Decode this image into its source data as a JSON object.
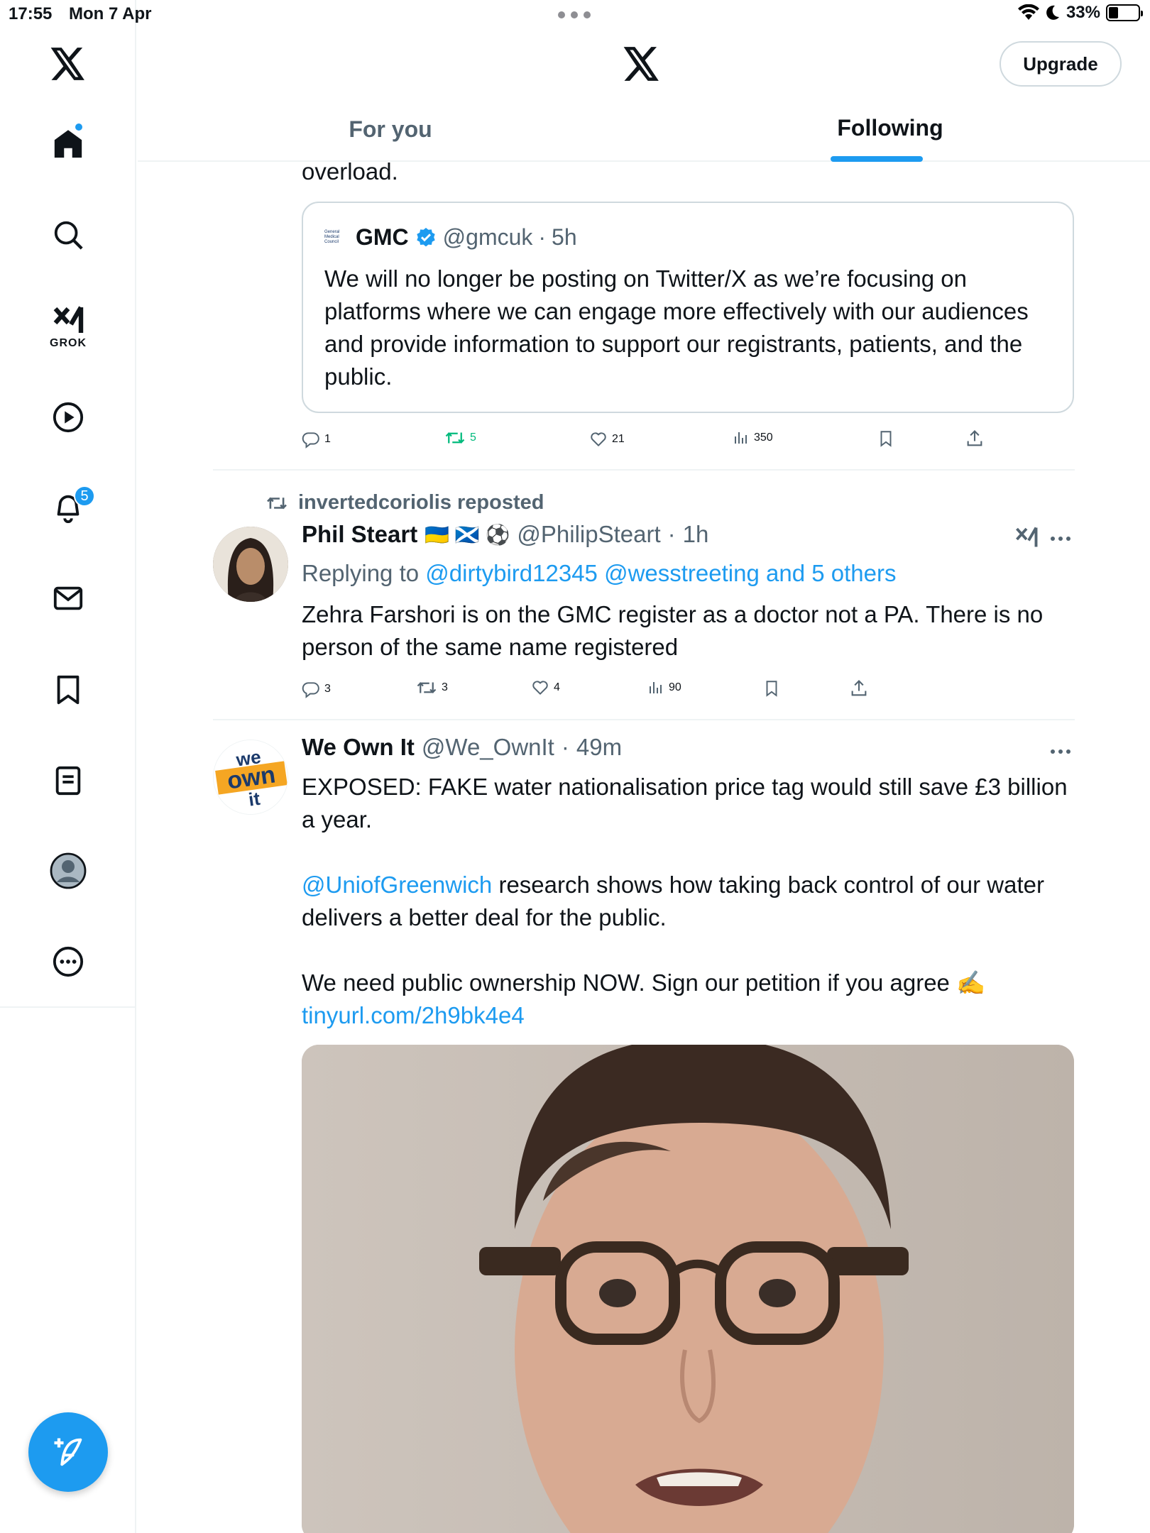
{
  "status_bar": {
    "time": "17:55",
    "date": "Mon 7 Apr",
    "battery": "33%",
    "battery_level": 0.33
  },
  "sidebar": {
    "grok_label": "GROK",
    "notifications_badge": "5"
  },
  "header": {
    "upgrade_label": "Upgrade",
    "tabs": [
      {
        "label": "For you",
        "selected": false
      },
      {
        "label": "Following",
        "selected": true
      }
    ]
  },
  "tweet1": {
    "text_tail": "overload.",
    "quote": {
      "name": "GMC",
      "logo_text": [
        "General",
        "Medical",
        "Council"
      ],
      "handle": "@gmcuk",
      "sep": "·",
      "time": "5h",
      "text": "We will no longer be posting on Twitter/X as we’re focusing on platforms where we can engage more effectively with our audiences and provide information to support our registrants, patients, and the public."
    },
    "replies": "1",
    "reposts": "5",
    "likes": "21",
    "views": "350"
  },
  "tweet2": {
    "repost_label": "invertedcoriolis reposted",
    "name": "Phil Steart",
    "name_emoji": "🇺🇦 🏴󠁧󠁢󠁳󠁣󠁴󠁿 ⚽",
    "handle": "@PhilipSteart",
    "sep": "·",
    "time": "1h",
    "replying_prefix": "Replying to",
    "replying_to": "@dirtybird12345 @wesstreeting and 5 others",
    "text": "Zehra Farshori is on the GMC register as a doctor not a PA. There is no person of the same name registered",
    "replies": "3",
    "reposts": "3",
    "likes": "4",
    "views": "90"
  },
  "tweet3": {
    "name": "We Own It",
    "avatar_text": [
      "we",
      "own",
      "it"
    ],
    "handle": "@We_OwnIt",
    "sep": "·",
    "time": "49m",
    "text1": "EXPOSED: FAKE water nationalisation price tag would still save £3 billion a year.",
    "mention": "@UniofGreenwich",
    "text2": " research shows how taking back control of our water delivers a better deal for the public.",
    "text3": "We need public ownership NOW. Sign our petition if you agree ✍️",
    "url": "tinyurl.com/2h9bk4e4"
  },
  "colors": {
    "accent": "#1d9bf0",
    "repost_active": "#00ba7c",
    "muted": "#536471",
    "border": "#cfd9de"
  },
  "icons": [
    "x-logo-icon",
    "home-icon",
    "search-icon",
    "grok-icon",
    "video-icon",
    "bell-icon",
    "mail-icon",
    "bookmark-icon",
    "lists-icon",
    "profile-icon",
    "more-icon",
    "compose-icon",
    "reply-icon",
    "repost-icon",
    "like-icon",
    "views-icon",
    "share-icon",
    "verified-icon",
    "wifi-icon",
    "moon-icon",
    "battery-icon"
  ]
}
